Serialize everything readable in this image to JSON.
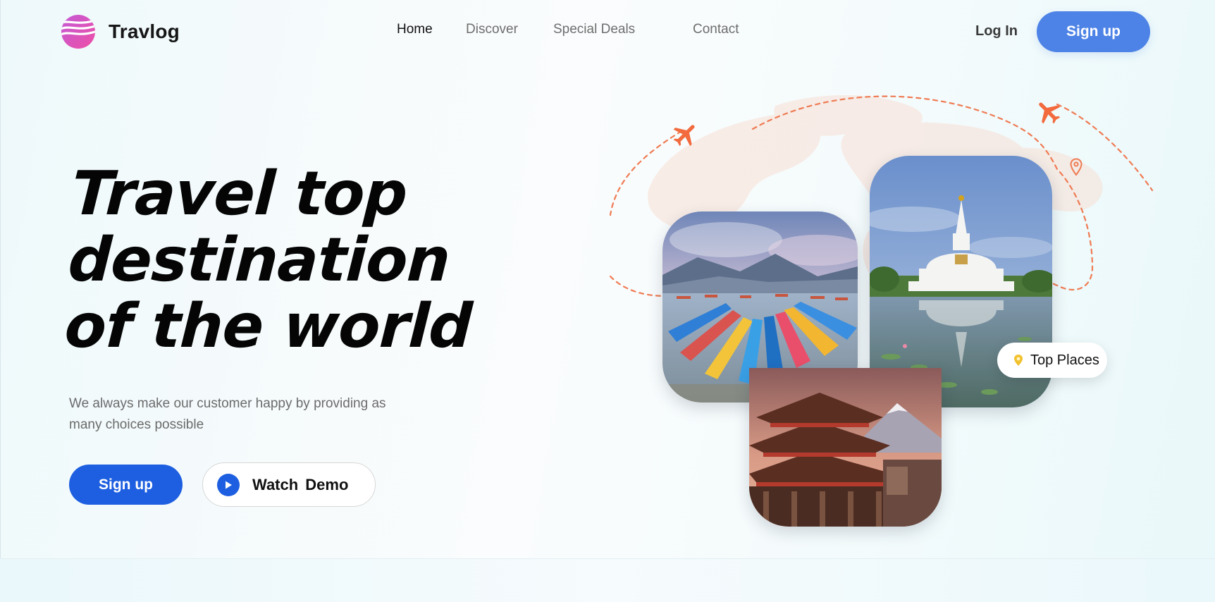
{
  "brand": {
    "name": "Travlog"
  },
  "nav": {
    "links": [
      "Home",
      "Discover",
      "Special Deals",
      "Contact"
    ],
    "active": "Home",
    "login_label": "Log In",
    "signup_label": "Sign up"
  },
  "hero": {
    "headline_lines": [
      "Travel top",
      "destination",
      "of the world"
    ],
    "subtitle": "We always make our customer happy by providing as many choices possible",
    "primary_cta": "Sign up",
    "secondary_cta": "Watch  Demo"
  },
  "gallery": {
    "badge_label": "Top Places",
    "images": [
      "lake-boats-photo",
      "temple-photo",
      "stupa-photo"
    ]
  },
  "colors": {
    "primary_blue": "#1d5fe0",
    "nav_signup_blue": "#4d83e6",
    "route_orange": "#ef7b53",
    "badge_pin_yellow": "#f2c12e"
  }
}
